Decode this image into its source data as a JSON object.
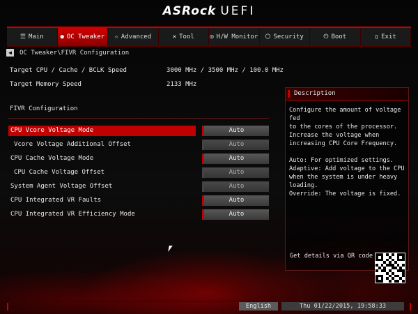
{
  "header": {
    "brand": "ASRock",
    "product": "UEFI"
  },
  "tabs": [
    {
      "label": "Main",
      "icon": "list-icon",
      "active": false
    },
    {
      "label": "OC Tweaker",
      "icon": "flame-icon",
      "active": true
    },
    {
      "label": "Advanced",
      "icon": "star-icon",
      "active": false
    },
    {
      "label": "Tool",
      "icon": "tools-icon",
      "active": false
    },
    {
      "label": "H/W Monitor",
      "icon": "monitor-icon",
      "active": false
    },
    {
      "label": "Security",
      "icon": "shield-icon",
      "active": false
    },
    {
      "label": "Boot",
      "icon": "power-icon",
      "active": false
    },
    {
      "label": "Exit",
      "icon": "exit-icon",
      "active": false
    }
  ],
  "breadcrumb": "OC Tweaker\\FIVR Configuration",
  "info": [
    {
      "label": "Target CPU / Cache / BCLK Speed",
      "value": "3000 MHz / 3500 MHz / 100.0 MHz"
    },
    {
      "label": "Target Memory Speed",
      "value": "2133 MHz"
    }
  ],
  "section_title": "FIVR Configuration",
  "settings": [
    {
      "label": "CPU Vcore Voltage Mode",
      "value": "Auto",
      "selected": true,
      "enabled": true,
      "sub": false
    },
    {
      "label": "Vcore Voltage Additional Offset",
      "value": "Auto",
      "selected": false,
      "enabled": false,
      "sub": true
    },
    {
      "label": "CPU Cache Voltage Mode",
      "value": "Auto",
      "selected": false,
      "enabled": true,
      "sub": false
    },
    {
      "label": "CPU Cache Voltage Offset",
      "value": "Auto",
      "selected": false,
      "enabled": false,
      "sub": true
    },
    {
      "label": "System Agent Voltage Offset",
      "value": "Auto",
      "selected": false,
      "enabled": false,
      "sub": false
    },
    {
      "label": "CPU Integrated VR Faults",
      "value": "Auto",
      "selected": false,
      "enabled": true,
      "sub": false
    },
    {
      "label": "CPU Integrated VR Efficiency Mode",
      "value": "Auto",
      "selected": false,
      "enabled": true,
      "sub": false
    }
  ],
  "description": {
    "title": "Description",
    "text": "Configure the amount of voltage fed\nto the cores of the processor.\nIncrease the voltage when\nincreasing CPU Core Frequency.\n\nAuto: For optimized settings.\nAdaptive: Add voltage to the CPU\nwhen the system is under heavy\nloading.\nOverride: The voltage is fixed.",
    "qr_label": "Get details via QR code"
  },
  "footer": {
    "language": "English",
    "datetime": "Thu 01/22/2015, 19:58:33"
  },
  "colors": {
    "accent": "#c40000",
    "background": "#000000"
  }
}
